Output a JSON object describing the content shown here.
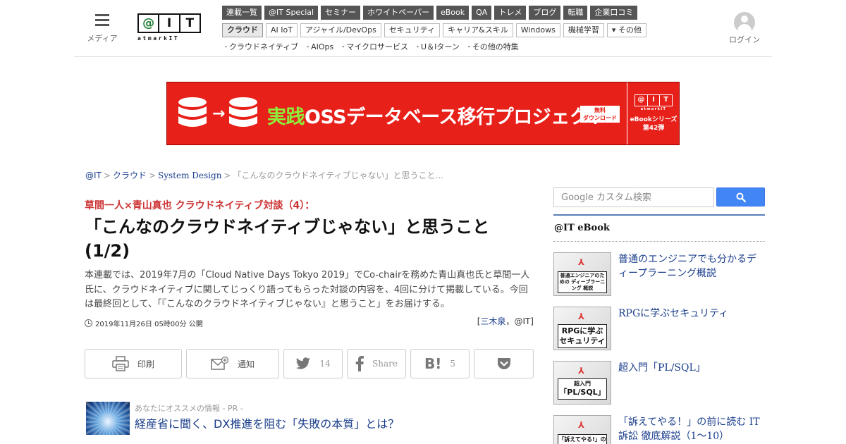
{
  "header": {
    "menu_label": "メディア",
    "logo": {
      "at": "@",
      "i": "I",
      "t": "T",
      "sub": "atmarkIT"
    },
    "nav_primary": [
      "連載一覧",
      "@IT Special",
      "セミナー",
      "ホワイトペーパー",
      "eBook",
      "QA",
      "トレメ",
      "ブログ",
      "転職",
      "企業口コミ"
    ],
    "nav_secondary": [
      "クラウド",
      "AI IoT",
      "アジャイル/DevOps",
      "セキュリティ",
      "キャリア&スキル",
      "Windows",
      "機械学習",
      "▾ その他"
    ],
    "nav_tertiary": [
      "クラウドネイティブ",
      "AIOps",
      "マイクロサービス",
      "U＆Iターン",
      "その他の特集"
    ],
    "login_label": "ログイン"
  },
  "banner": {
    "arrow": "→",
    "title_highlight": "実践",
    "title_rest": "OSSデータベース移行プロジェクト",
    "free_line1": "無料",
    "free_line2": "ダウンロード",
    "logo_at": "@",
    "logo_i": "I",
    "logo_t": "T",
    "logo_sub": "atmarkIT",
    "series_line1": "eBookシリーズ",
    "series_line2": "第42弾"
  },
  "breadcrumb": {
    "items": [
      "@IT",
      "クラウド",
      "System Design"
    ],
    "current": "「こんなのクラウドネイティブじゃない」と思うこと...",
    "sep": ">"
  },
  "article": {
    "kicker": "草間一人×青山真也 クラウドネイティブ対談（4）：",
    "headline": "「こんなのクラウドネイティブじゃない」と思うこと (1/2)",
    "lede": "本連載では、2019年7月の「Cloud Native Days Tokyo 2019」でCo-chairを務めた青山真也氏と草間一人氏に、クラウドネイティブに関してじっくり語ってもらった対談の内容を、4回に分けて掲載している。今回は最終回として、「『こんなのクラウドネイティブじゃない』と思うこと」をお届けする。",
    "date": "2019年11月26日 05時00分 公開",
    "author_open": "[",
    "author_name": "三木泉",
    "author_rest": "，@IT]"
  },
  "share": {
    "print_label": "印刷",
    "notify_label": "通知",
    "tweet_count": "14",
    "facebook_label": "Share",
    "hatena_count": "5"
  },
  "pr": {
    "label": "あなたにオススメの情報 - PR -",
    "title": "経産省に聞く、DX推進を阻む「失敗の本質」とは？"
  },
  "sidebar": {
    "search_placeholder": "Google カスタム検索",
    "ebook_title": "@IT eBook",
    "ebooks": [
      {
        "title": "普通のエンジニアでも分かるディープラーニング概説",
        "cover": "普通エンジニアのための ディープラーニング 概説"
      },
      {
        "title": "RPGに学ぶセキュリティ",
        "cover": "RPGに学ぶ セキュリティ"
      },
      {
        "title": "超入門「PL/SQL」",
        "cover_top": "超入門",
        "cover": "「PL/SQL」"
      },
      {
        "title": "「訴えてやる！」の前に読む IT訴訟 徹底解説（1～10）",
        "cover": "「訴えてやる!」の前に読む"
      }
    ]
  },
  "colors": {
    "accent_red": "#e8201a",
    "link_blue": "#1a3e8c",
    "kicker_red": "#cc3333",
    "google_blue": "#4285f4"
  }
}
